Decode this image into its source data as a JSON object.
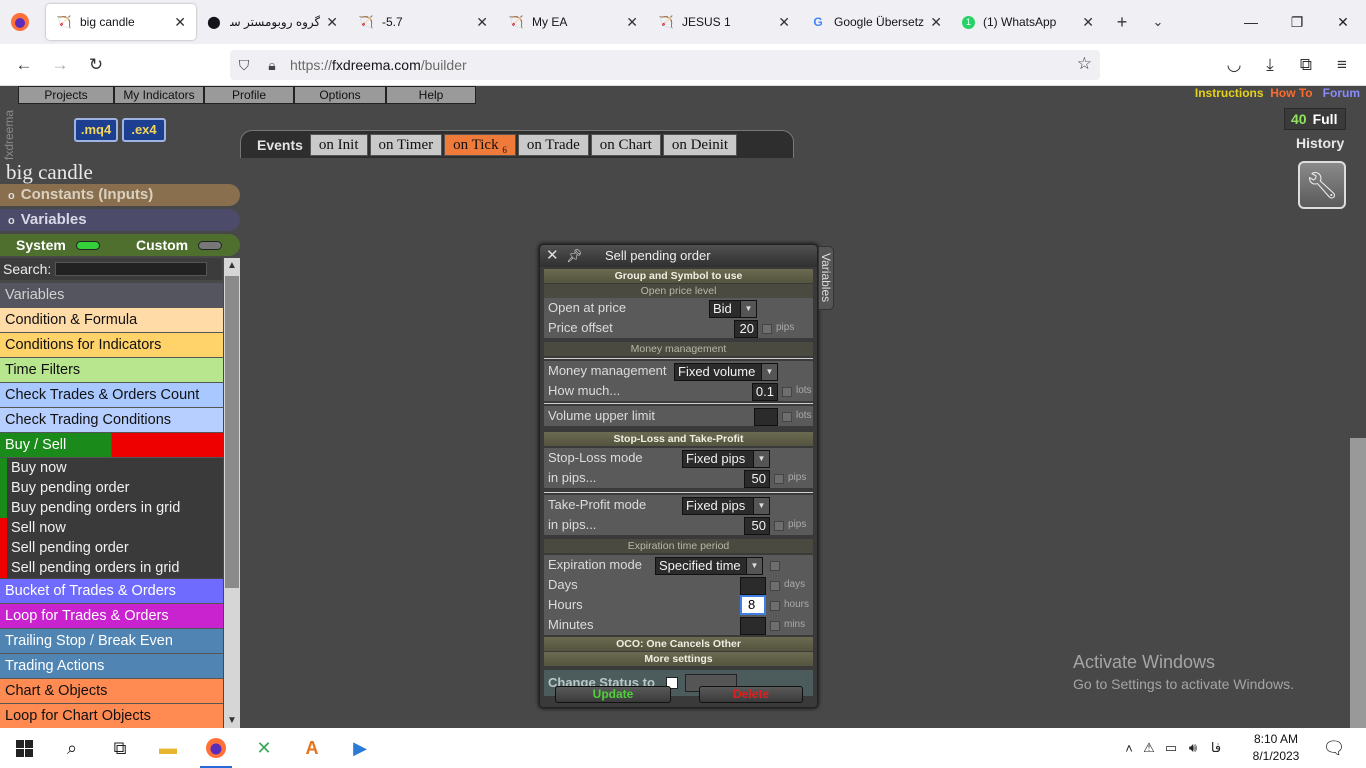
{
  "browser": {
    "tabs": [
      {
        "title": "big candle",
        "icon": "fxdreema-icon",
        "active": true
      },
      {
        "title": "گروه روبومستر سا",
        "icon": "github-icon"
      },
      {
        "title": "-5.7",
        "icon": "fxdreema-icon"
      },
      {
        "title": "My EA",
        "icon": "fxdreema-icon"
      },
      {
        "title": "JESUS 1",
        "icon": "fxdreema-icon"
      },
      {
        "title": "Google Übersetzer",
        "icon": "google-translate-icon"
      },
      {
        "title": "(1) WhatsApp",
        "icon": "whatsapp-icon",
        "badge": "1"
      }
    ],
    "url_prefix": "https://",
    "url_domain": "fxdreema.com",
    "url_path": "/builder"
  },
  "app": {
    "logo_text": "fxdreema",
    "menu": [
      "Projects",
      "My Indicators",
      "Profile",
      "Options",
      "Help"
    ],
    "badges": [
      ".mq4",
      ".ex4"
    ],
    "links": {
      "instructions": "Instructions",
      "howto": "How To",
      "forum": "Forum"
    },
    "counter_value": "40",
    "counter_label": "Full",
    "history_label": "History",
    "events_label": "Events",
    "events": [
      "on Init",
      "on Timer",
      "on Tick",
      "on Trade",
      "on Chart",
      "on Deinit"
    ],
    "active_event_index": 2,
    "tick_suffix": "6"
  },
  "sidebar": {
    "project_title": "big candle",
    "constants_label": "Constants (Inputs)",
    "variables_label": "Variables",
    "system_label": "System",
    "custom_label": "Custom",
    "search_label": "Search:",
    "categories": [
      {
        "label": "Variables",
        "bg": "#55555f",
        "fg": "#d0d0d0"
      },
      {
        "label": "Condition & Formula",
        "bg": "#ffdba8"
      },
      {
        "label": "Conditions for Indicators",
        "bg": "#ffd36a"
      },
      {
        "label": "Time Filters",
        "bg": "#b8e68f"
      },
      {
        "label": "Check Trades & Orders Count",
        "bg": "#a8c8ff"
      },
      {
        "label": "Check Trading Conditions",
        "bg": "#b7cfff"
      }
    ],
    "buy_sell_label": "Buy / Sell",
    "buy_items": [
      "Buy now",
      "Buy pending order",
      "Buy pending orders in grid"
    ],
    "sell_items": [
      "Sell now",
      "Sell pending order",
      "Sell pending orders in grid"
    ],
    "more_categories": [
      {
        "label": "Bucket of Trades & Orders",
        "bg": "#6f6bff",
        "fg": "#ffffff"
      },
      {
        "label": "Loop for Trades & Orders",
        "bg": "#c922cf",
        "fg": "#ffffff"
      },
      {
        "label": "Trailing Stop / Break Even",
        "bg": "#4f84b3",
        "fg": "#ffffff"
      },
      {
        "label": "Trading Actions",
        "bg": "#4f84b3",
        "fg": "#ffffff"
      },
      {
        "label": "Chart & Objects",
        "bg": "#ff8a52"
      },
      {
        "label": "Loop for Chart Objects",
        "bg": "#ff8a52"
      }
    ]
  },
  "dialog": {
    "title": "Sell pending order",
    "variables_tab": "Variables",
    "group_symbol": "Group and Symbol to use",
    "open_price_section": "Open price level",
    "open_at_price_label": "Open at price",
    "open_at_price_value": "Bid",
    "price_offset_label": "Price offset",
    "price_offset_value": "20",
    "pips": "pips",
    "money_section": "Money management",
    "money_mgmt_label": "Money management",
    "money_mgmt_value": "Fixed volume",
    "how_much_label": "How much...",
    "how_much_value": "0.1",
    "lots": "lots",
    "volume_limit_label": "Volume upper limit",
    "volume_limit_value": "",
    "sltp_section": "Stop-Loss and Take-Profit",
    "sl_mode_label": "Stop-Loss mode",
    "sl_mode_value": "Fixed pips",
    "sl_pips_label": "in pips...",
    "sl_pips_value": "50",
    "tp_mode_label": "Take-Profit mode",
    "tp_mode_value": "Fixed pips",
    "tp_pips_label": "in pips...",
    "tp_pips_value": "50",
    "expiration_section": "Expiration time period",
    "exp_mode_label": "Expiration mode",
    "exp_mode_value": "Specified time",
    "days_label": "Days",
    "days_value": "",
    "days_unit": "days",
    "hours_label": "Hours",
    "hours_value": "8",
    "hours_unit": "hours",
    "minutes_label": "Minutes",
    "minutes_value": "",
    "minutes_unit": "mins",
    "oco_section": "OCO: One Cancels Other",
    "more_section": "More settings",
    "change_status_label": "Change Status to",
    "update_label": "Update",
    "delete_label": "Delete"
  },
  "watermark": {
    "line1": "Activate Windows",
    "line2": "Go to Settings to activate Windows."
  },
  "taskbar": {
    "time": "8:10 AM",
    "date": "8/1/2023",
    "lang": "فا"
  },
  "colors": {
    "active_event": "#f07a3a",
    "buy": "#1a8a1a",
    "sell": "#ee0000",
    "instructions": "#e5d21a",
    "howto": "#ff6a2a",
    "forum": "#8a8aff"
  }
}
